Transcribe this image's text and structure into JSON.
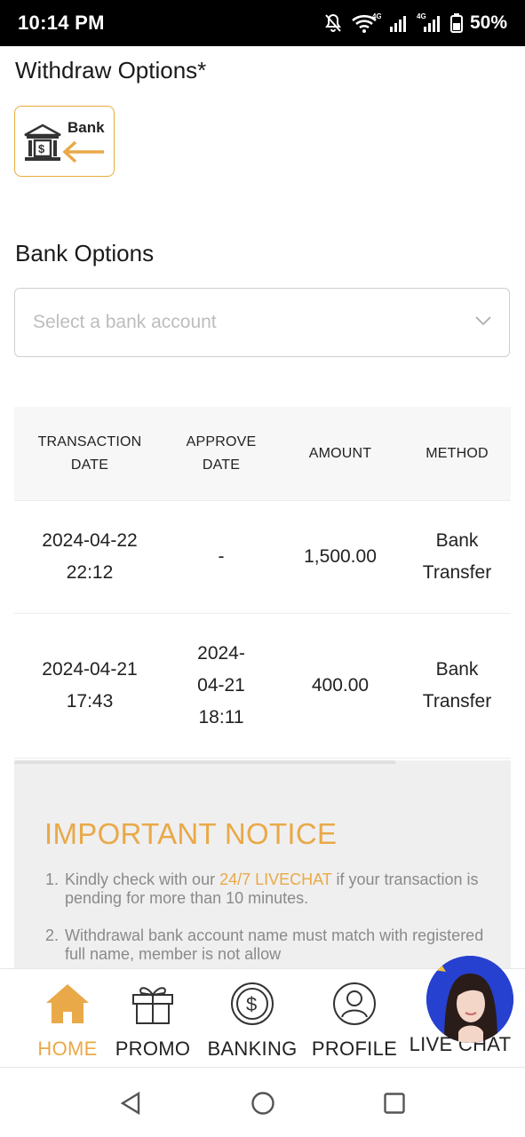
{
  "status": {
    "time": "10:14 PM",
    "network_label": "4G",
    "battery": "50%"
  },
  "withdraw": {
    "title": "Withdraw Options*",
    "option_label": "Bank"
  },
  "bank": {
    "title": "Bank Options",
    "select_placeholder": "Select a bank account"
  },
  "table": {
    "headers": [
      [
        "TRANSACTION",
        "DATE"
      ],
      [
        "APPROVE",
        "DATE"
      ],
      [
        "AMOUNT"
      ],
      [
        "METHOD"
      ]
    ],
    "rows": [
      {
        "date": [
          "2024-04-22",
          "22:12"
        ],
        "approve": [
          "-"
        ],
        "amount": "1,500.00",
        "method": [
          "Bank",
          "Transfer"
        ]
      },
      {
        "date": [
          "2024-04-21",
          "17:43"
        ],
        "approve": [
          "2024-",
          "04-21",
          "18:11"
        ],
        "amount": "400.00",
        "method": [
          "Bank",
          "Transfer"
        ]
      }
    ]
  },
  "notice": {
    "title": "IMPORTANT NOTICE",
    "items": [
      {
        "num": "1.",
        "before": "Kindly check with our ",
        "link": "24/7 LIVECHAT",
        "after": " if your transaction is pending for more than 10 minutes."
      },
      {
        "num": "2.",
        "before": "Withdrawal bank account name must match with registered full name, member is not allow",
        "link": "",
        "after": ""
      }
    ]
  },
  "nav": {
    "home": "HOME",
    "promo": "PROMO",
    "banking": "BANKING",
    "profile": "PROFILE",
    "livechat": "LIVE CHAT"
  },
  "colors": {
    "accent": "#e9a948",
    "notice_bg": "#efefef",
    "status_bar": "#000000"
  }
}
